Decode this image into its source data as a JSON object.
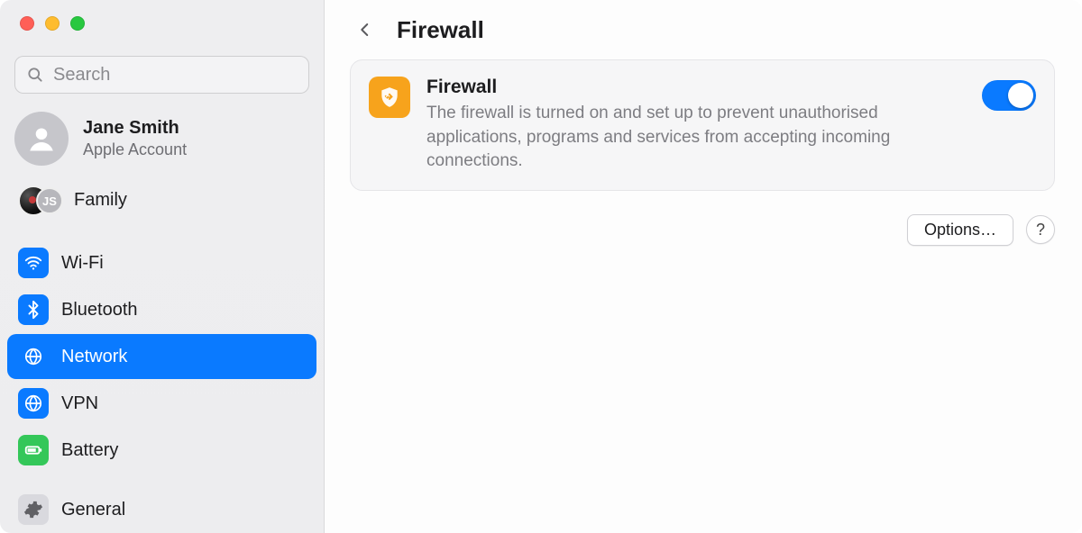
{
  "search": {
    "placeholder": "Search"
  },
  "account": {
    "name": "Jane Smith",
    "subtitle": "Apple Account"
  },
  "family": {
    "label": "Family",
    "sharedAvatarInitials": "JS"
  },
  "sidebar": {
    "items": [
      {
        "label": "Wi-Fi"
      },
      {
        "label": "Bluetooth"
      },
      {
        "label": "Network"
      },
      {
        "label": "VPN"
      },
      {
        "label": "Battery"
      },
      {
        "label": "General"
      }
    ],
    "selectedIndex": 2
  },
  "header": {
    "title": "Firewall"
  },
  "panel": {
    "icon": "firewall-shield-icon",
    "title": "Firewall",
    "description": "The firewall is turned on and set up to prevent unauthorised applications, programs and services from accepting incoming connections.",
    "toggleOn": true
  },
  "actions": {
    "optionsLabel": "Options…",
    "helpLabel": "?"
  },
  "annotation": {
    "arrowColor": "#e0492e"
  },
  "colors": {
    "accentBlue": "#0a7aff",
    "batteryGreen": "#34c759",
    "firewallOrange": "#f7a31c"
  }
}
